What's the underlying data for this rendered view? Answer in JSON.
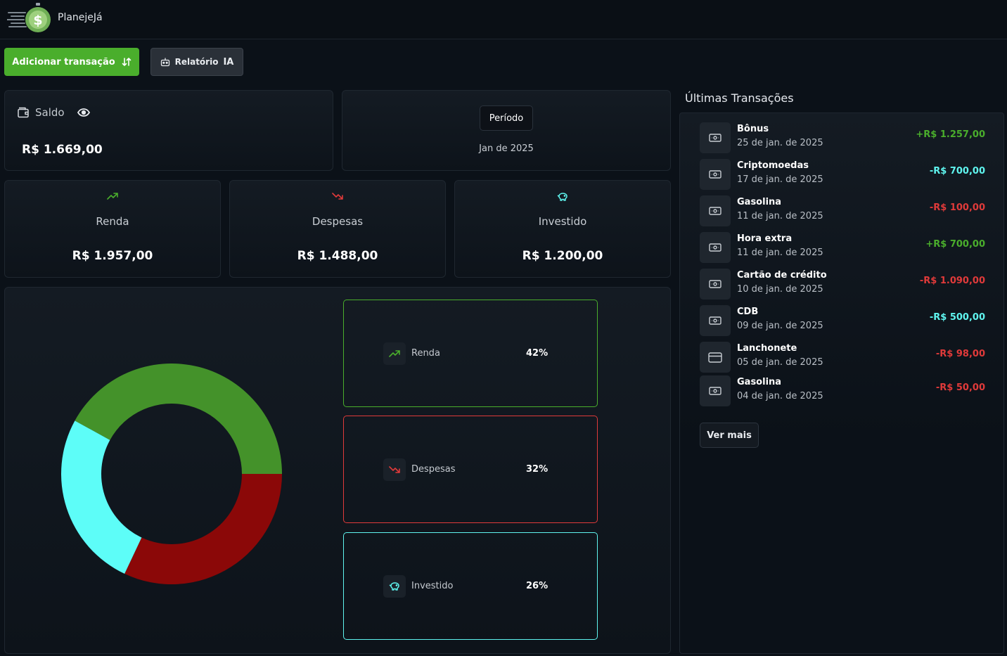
{
  "colors": {
    "renda": "#4aae2c",
    "despesas": "#e03a3a",
    "investido": "#5ff5ef",
    "donut_renda": "#44922a",
    "donut_despesas": "#8b0808",
    "donut_investido": "#5dfdf8"
  },
  "brand": {
    "name": "PlanejeJá",
    "logo_icon": "dollar-coin-icon"
  },
  "toolbar": {
    "add_label": "Adicionar transação",
    "ia_label": "Relatório",
    "ia_suffix": "IA"
  },
  "saldo": {
    "label": "Saldo",
    "value": "R$ 1.669,00"
  },
  "periodo": {
    "label": "Período",
    "value": "Jan de 2025"
  },
  "stats": [
    {
      "label": "Renda",
      "value": "R$ 1.957,00",
      "icon": "trending-up-icon"
    },
    {
      "label": "Despesas",
      "value": "R$ 1.488,00",
      "icon": "trending-down-icon"
    },
    {
      "label": "Investido",
      "value": "R$ 1.200,00",
      "icon": "piggy-bank-icon"
    }
  ],
  "chart_data": {
    "type": "pie",
    "categories": [
      "Renda",
      "Despesas",
      "Investido"
    ],
    "values": [
      42,
      32,
      26
    ],
    "colors": [
      "#44922a",
      "#8b0808",
      "#5dfdf8"
    ],
    "donut": true
  },
  "legend": [
    {
      "name": "Renda",
      "pct": "42%"
    },
    {
      "name": "Despesas",
      "pct": "32%"
    },
    {
      "name": "Investido",
      "pct": "26%"
    }
  ],
  "transactions": {
    "title": "Últimas Transações",
    "items": [
      {
        "name": "Bônus",
        "date": "25 de jan. de 2025",
        "amount": "+R$ 1.257,00",
        "kind": "renda",
        "icon": "banknote-icon"
      },
      {
        "name": "Criptomoedas",
        "date": "17 de jan. de 2025",
        "amount": "-R$ 700,00",
        "kind": "investido",
        "icon": "banknote-icon"
      },
      {
        "name": "Gasolina",
        "date": "11 de jan. de 2025",
        "amount": "-R$ 100,00",
        "kind": "despesas",
        "icon": "banknote-icon"
      },
      {
        "name": "Hora extra",
        "date": "11 de jan. de 2025",
        "amount": "+R$ 700,00",
        "kind": "renda",
        "icon": "banknote-icon"
      },
      {
        "name": "Cartão de crédito",
        "date": "10 de jan. de 2025",
        "amount": "-R$ 1.090,00",
        "kind": "despesas",
        "icon": "banknote-icon"
      },
      {
        "name": "CDB",
        "date": "09 de jan. de 2025",
        "amount": "-R$ 500,00",
        "kind": "investido",
        "icon": "banknote-icon"
      },
      {
        "name": "Lanchonete",
        "date": "05 de jan. de 2025",
        "amount": "-R$ 98,00",
        "kind": "despesas",
        "icon": "credit-card-icon"
      },
      {
        "name": "Gasolina",
        "date": "04 de jan. de 2025",
        "amount": "-R$ 50,00",
        "kind": "despesas",
        "icon": "banknote-icon"
      }
    ],
    "more_label": "Ver mais"
  }
}
